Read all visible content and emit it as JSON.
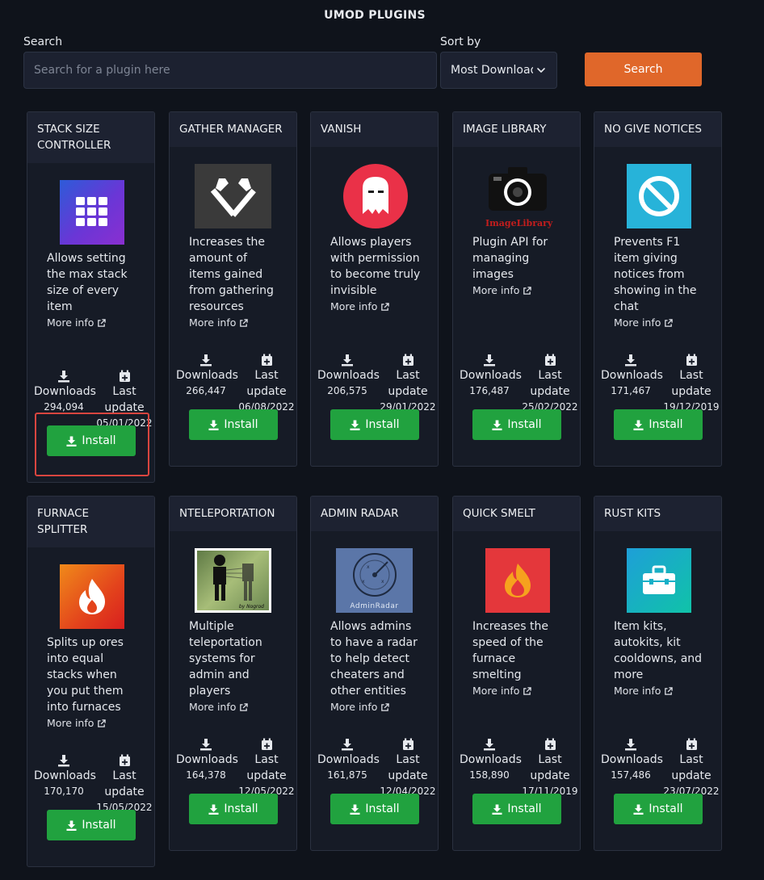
{
  "header": {
    "title": "UMOD PLUGINS"
  },
  "search": {
    "label": "Search",
    "placeholder": "Search for a plugin here",
    "value": "",
    "button_label": "Search"
  },
  "sort": {
    "label": "Sort by",
    "selected": "Most Downloads"
  },
  "labels": {
    "downloads": "Downloads",
    "last": "Last",
    "update": "update",
    "more_info": "More info",
    "install": "Install"
  },
  "colors": {
    "background": "#0f131b",
    "card": "#161b26",
    "accent": "#e0672a",
    "install": "#21a23f",
    "highlight": "#d9453f"
  },
  "plugins": [
    {
      "title": "STACK SIZE CONTROLLER",
      "title_lines": [
        "STACK SIZE",
        "CONTROLLER"
      ],
      "description": "Allows setting the max stack size of every item",
      "desc_lines": [
        "Allows setting",
        "the max stack",
        "size of every",
        "item"
      ],
      "downloads": "294,094",
      "last_update": "05/01/2022",
      "icon": "grid-icon",
      "highlighted": true
    },
    {
      "title": "GATHER MANAGER",
      "title_lines": [
        "GATHER MANAGER"
      ],
      "description": "Increases the amount of items gained from gathering resources",
      "desc_lines": [
        "Increases the",
        "amount of",
        "items gained",
        "from gathering",
        "resources"
      ],
      "downloads": "266,447",
      "last_update": "06/08/2022",
      "icon": "crossed-axes-icon",
      "highlighted": false
    },
    {
      "title": "VANISH",
      "title_lines": [
        "VANISH"
      ],
      "description": "Allows players with permission to become truly invisible",
      "desc_lines": [
        "Allows players",
        "with permission",
        "to become truly",
        "invisible"
      ],
      "downloads": "206,575",
      "last_update": "29/01/2022",
      "icon": "ghost-icon",
      "highlighted": false
    },
    {
      "title": "IMAGE LIBRARY",
      "title_lines": [
        "IMAGE LIBRARY"
      ],
      "description": "Plugin API for managing images",
      "desc_lines": [
        "Plugin API for",
        "managing",
        "images"
      ],
      "downloads": "176,487",
      "last_update": "25/02/2022",
      "icon": "camera-icon",
      "logo_text": "ImageLibrary",
      "highlighted": false
    },
    {
      "title": "NO GIVE NOTICES",
      "title_lines": [
        "NO GIVE NOTICES"
      ],
      "description": "Prevents F1 item giving notices from showing in the chat",
      "desc_lines": [
        "Prevents F1",
        "item giving",
        "notices from",
        "showing in the",
        "chat"
      ],
      "downloads": "171,467",
      "last_update": "19/12/2019",
      "icon": "no-entry-icon",
      "highlighted": false
    },
    {
      "title": "FURNACE SPLITTER",
      "title_lines": [
        "FURNACE",
        "SPLITTER"
      ],
      "description": "Splits up ores into equal stacks when you put them into furnaces",
      "desc_lines": [
        "Splits up ores",
        "into equal",
        "stacks when",
        "you put them",
        "into furnaces"
      ],
      "downloads": "170,170",
      "last_update": "15/05/2022",
      "icon": "flame-icon",
      "highlighted": false
    },
    {
      "title": "NTELEPORTATION",
      "title_lines": [
        "NTELEPORTATION"
      ],
      "description": "Multiple teleportation systems for admin and players",
      "desc_lines": [
        "Multiple",
        "teleportation",
        "systems for",
        "admin and",
        "players"
      ],
      "downloads": "164,378",
      "last_update": "12/05/2022",
      "icon": "teleport-figure-icon",
      "logo_text": "by Nogrod",
      "highlighted": false
    },
    {
      "title": "ADMIN RADAR",
      "title_lines": [
        "ADMIN RADAR"
      ],
      "description": "Allows admins to have a radar to help detect cheaters and other entities",
      "desc_lines": [
        "Allows admins",
        "to have a radar",
        "to help detect",
        "cheaters and",
        "other entities"
      ],
      "downloads": "161,875",
      "last_update": "12/04/2022",
      "icon": "radar-icon",
      "logo_text": "AdminRadar",
      "highlighted": false
    },
    {
      "title": "QUICK SMELT",
      "title_lines": [
        "QUICK SMELT"
      ],
      "description": "Increases the speed of the furnace smelting",
      "desc_lines": [
        "Increases the",
        "speed of the",
        "furnace",
        "smelting"
      ],
      "downloads": "158,890",
      "last_update": "17/11/2019",
      "icon": "fire-icon",
      "highlighted": false
    },
    {
      "title": "RUST KITS",
      "title_lines": [
        "RUST KITS"
      ],
      "description": "Item kits, autokits, kit cooldowns, and more",
      "desc_lines": [
        "Item kits,",
        "autokits, kit",
        "cooldowns, and",
        "more"
      ],
      "downloads": "157,486",
      "last_update": "23/07/2022",
      "icon": "toolbox-icon",
      "highlighted": false
    }
  ]
}
